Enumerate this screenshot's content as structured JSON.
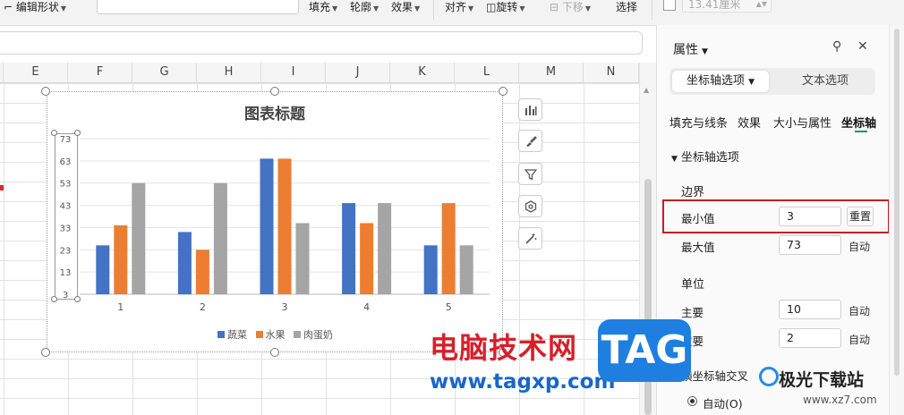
{
  "ribbon": {
    "edit_shape": "编辑形状",
    "fill": "填充",
    "outline": "轮廓",
    "effect": "效果",
    "align": "对齐",
    "rotate": "旋转",
    "move_down": "下移",
    "select": "选择",
    "size_value": "13.41厘米"
  },
  "sheet": {
    "columns": [
      "E",
      "F",
      "G",
      "H",
      "I",
      "J",
      "K",
      "L",
      "M",
      "N"
    ]
  },
  "chart_data": {
    "type": "bar",
    "title": "图表标题",
    "categories": [
      "1",
      "2",
      "3",
      "4",
      "5"
    ],
    "series": [
      {
        "name": "蔬菜",
        "values": [
          25,
          31,
          64,
          44,
          25
        ],
        "color": "#4472c4"
      },
      {
        "name": "水果",
        "values": [
          34,
          23,
          64,
          35,
          44
        ],
        "color": "#ed7d31"
      },
      {
        "name": "肉蛋奶",
        "values": [
          53,
          53,
          35,
          44,
          25
        ],
        "color": "#a5a5a5"
      }
    ],
    "ylim": [
      3,
      73
    ],
    "yticks": [
      "3",
      "13",
      "23",
      "33",
      "43",
      "53",
      "63",
      "73"
    ],
    "grid": true,
    "legend": "bottom"
  },
  "panel": {
    "title": "属性",
    "tab_axis_options": "坐标轴选项",
    "tab_text_options": "文本选项",
    "subtabs": [
      "填充与线条",
      "效果",
      "大小与属性",
      "坐标轴"
    ],
    "section_axis": "坐标轴选项",
    "bounds": "边界",
    "min_label": "最小值",
    "min_value": "3",
    "reset": "重置",
    "max_label": "最大值",
    "max_value": "73",
    "auto": "自动",
    "units": "单位",
    "major_label": "主要",
    "major_value": "10",
    "minor_label": "次要",
    "minor_value": "2",
    "cross_label": "横坐标轴交叉",
    "auto_radio": "自动(O)"
  },
  "watermark": {
    "site_cn": "电脑技术网",
    "site_url": "www.tagxp.com",
    "tag": "TAG",
    "brand": "极光下载站",
    "brand_url": "www.xz7.com"
  },
  "colors": {
    "accent_green": "#1a9a5f",
    "highlight_red": "#c41e24"
  }
}
